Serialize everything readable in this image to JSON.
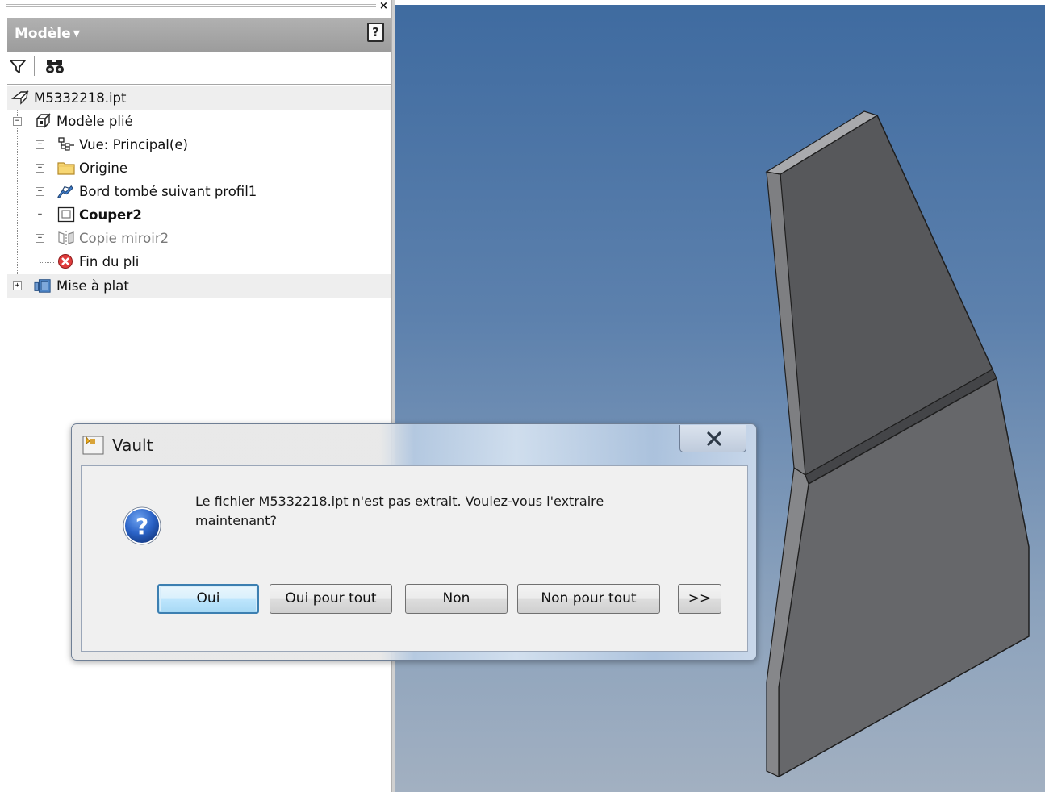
{
  "browser": {
    "title": "Modèle",
    "close_glyph": "×",
    "help_glyph": "?",
    "toolbar": {
      "icons": [
        "filter-icon",
        "find-icon"
      ]
    },
    "tree": [
      {
        "label": "M5332218.ipt",
        "icon": "part-icon",
        "level": 0,
        "expander": "",
        "highlighted": true
      },
      {
        "label": "Modèle plié",
        "icon": "folded-model-icon",
        "level": 0,
        "expander": "−",
        "highlighted": false
      },
      {
        "label": "Vue: Principal(e)",
        "icon": "view-rep-icon",
        "level": 1,
        "expander": "+",
        "highlighted": false
      },
      {
        "label": "Origine",
        "icon": "folder-icon",
        "level": 1,
        "expander": "+",
        "highlighted": false
      },
      {
        "label": "Bord tombé suivant profil1",
        "icon": "contour-flange-icon",
        "level": 1,
        "expander": "+",
        "highlighted": false
      },
      {
        "label": "Couper2",
        "icon": "cut-icon",
        "level": 1,
        "expander": "+",
        "highlighted": false,
        "bold": true
      },
      {
        "label": "Copie miroir2",
        "icon": "mirror-icon",
        "level": 1,
        "expander": "+",
        "highlighted": false,
        "suppressed": true
      },
      {
        "label": "Fin du pli",
        "icon": "end-of-part-icon",
        "level": 1,
        "expander": "",
        "highlighted": false
      },
      {
        "label": "Mise à plat",
        "icon": "flat-pattern-icon",
        "level": 0,
        "expander": "+",
        "highlighted": true
      }
    ]
  },
  "dialog": {
    "title": "Vault",
    "close_glyph": "X",
    "icon": "question-icon",
    "message_line1": "Le fichier M5332218.ipt n'est pas extrait. Voulez-vous l'extraire",
    "message_line2": "maintenant?",
    "buttons": {
      "yes": "Oui",
      "yes_all": "Oui pour tout",
      "no": "Non",
      "no_all": "Non pour tout",
      "more": ">>"
    }
  },
  "colors": {
    "viewport_top": "#3f6ba0",
    "viewport_bottom": "#a2b0c1",
    "part_face": "#5f6063",
    "part_edge": "#1e1e1e",
    "default_button_border": "#3c7fb1"
  }
}
